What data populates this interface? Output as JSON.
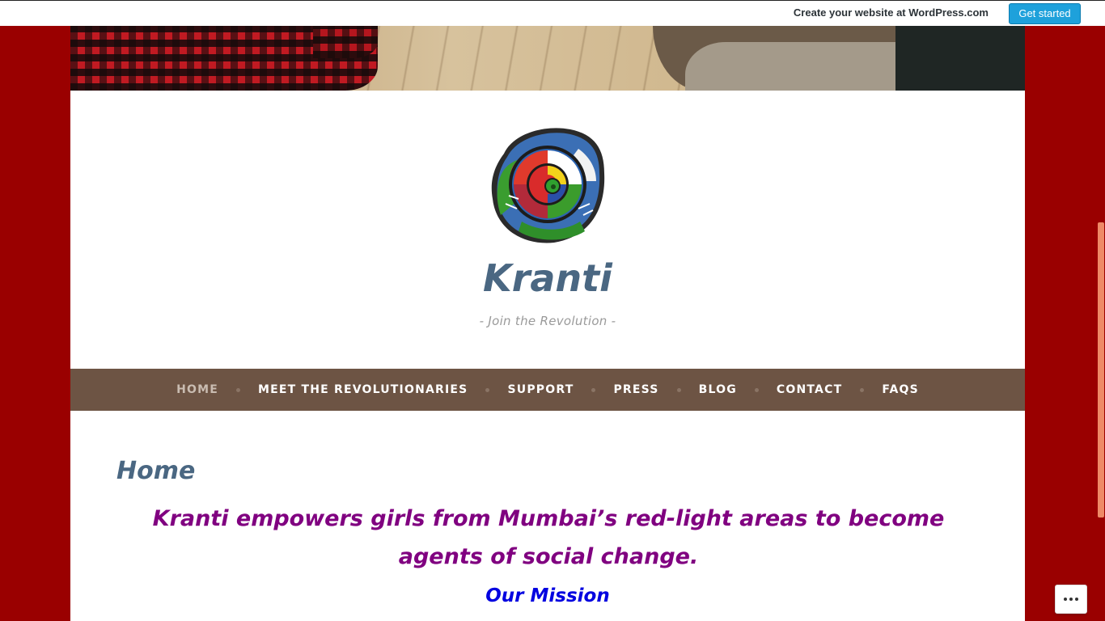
{
  "wpbar": {
    "promo_text": "Create your website at WordPress.com",
    "cta_label": "Get started"
  },
  "site": {
    "title": "Kranti",
    "tagline": "- Join the Revolution -"
  },
  "nav": {
    "items": [
      {
        "label": "HOME",
        "active": true
      },
      {
        "label": "MEET THE REVOLUTIONARIES",
        "active": false
      },
      {
        "label": "SUPPORT",
        "active": false
      },
      {
        "label": "PRESS",
        "active": false
      },
      {
        "label": "BLOG",
        "active": false
      },
      {
        "label": "CONTACT",
        "active": false
      },
      {
        "label": "FAQS",
        "active": false
      }
    ]
  },
  "content": {
    "heading": "Home",
    "lead": "Kranti empowers girls from Mumbai’s red-light areas to become agents of social change.",
    "subheading": "Our Mission"
  },
  "colors": {
    "background": "#9a0000",
    "nav_bg": "#6d5444",
    "title": "#4a6782",
    "lead": "#800080",
    "mission": "#0000e0",
    "cta": "#1ea1db"
  },
  "icons": {
    "more": "more-horizontal-icon",
    "logo": "kranti-spiral-logo"
  }
}
